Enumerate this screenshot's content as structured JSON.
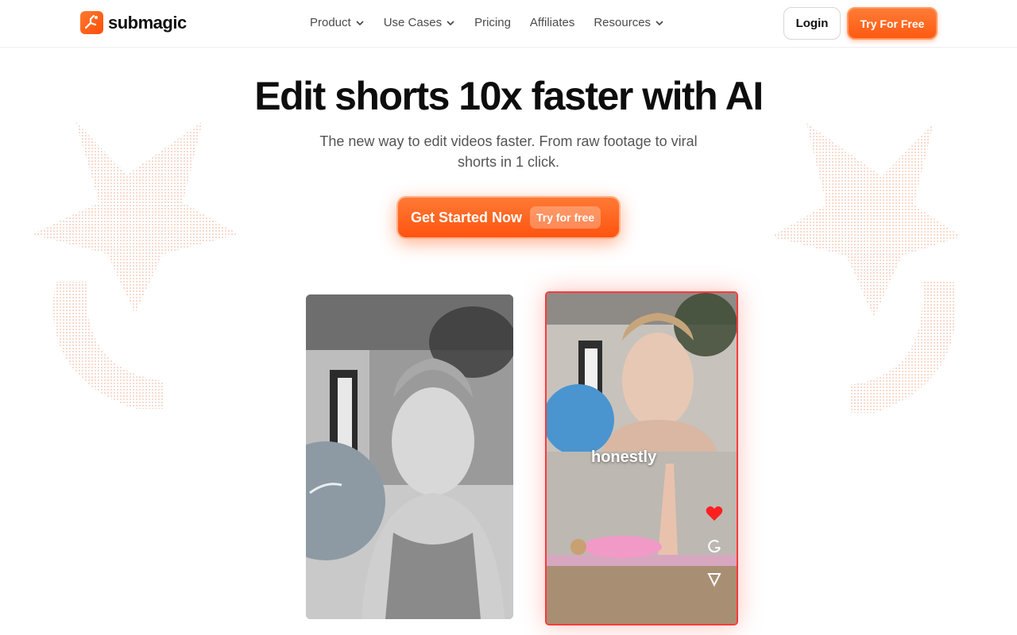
{
  "brand": {
    "name": "submagic",
    "accent": "#ff5a12"
  },
  "nav": {
    "items": [
      {
        "label": "Product",
        "dropdown": true
      },
      {
        "label": "Use Cases",
        "dropdown": true
      },
      {
        "label": "Pricing",
        "dropdown": false
      },
      {
        "label": "Affiliates",
        "dropdown": false
      },
      {
        "label": "Resources",
        "dropdown": true
      }
    ],
    "login_label": "Login",
    "try_label": "Try For Free"
  },
  "hero": {
    "title": "Edit shorts 10x faster with AI",
    "subtitle": "The new way to edit videos faster. From raw footage to viral shorts in 1 click.",
    "cta_label": "Get Started Now",
    "cta_badge": "Try for free"
  },
  "preview": {
    "caption_word": "honestly",
    "icons": [
      "heart-icon",
      "share-icon",
      "send-icon"
    ]
  }
}
